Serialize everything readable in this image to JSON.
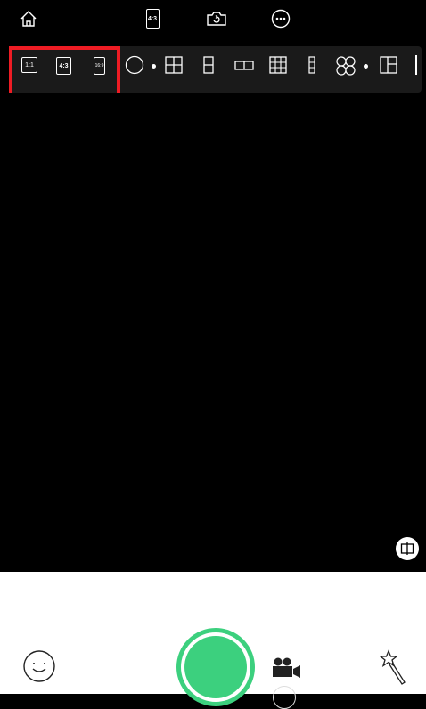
{
  "top": {
    "ratio_label": "4:3"
  },
  "ratios": [
    {
      "label": "1:1",
      "active": false
    },
    {
      "label": "4:3",
      "active": true
    },
    {
      "label": "16:9",
      "active": false
    }
  ],
  "colors": {
    "accent": "#3cd07e",
    "highlight": "#ee1c24",
    "bar": "#1a1a1a"
  },
  "icons": {
    "home": "home-icon",
    "ratio": "aspect-ratio-icon",
    "switch_camera": "switch-camera-icon",
    "more": "more-icon",
    "split_view": "split-view-icon",
    "face": "face-icon",
    "video": "video-camera-icon",
    "magic": "magic-wand-icon"
  }
}
